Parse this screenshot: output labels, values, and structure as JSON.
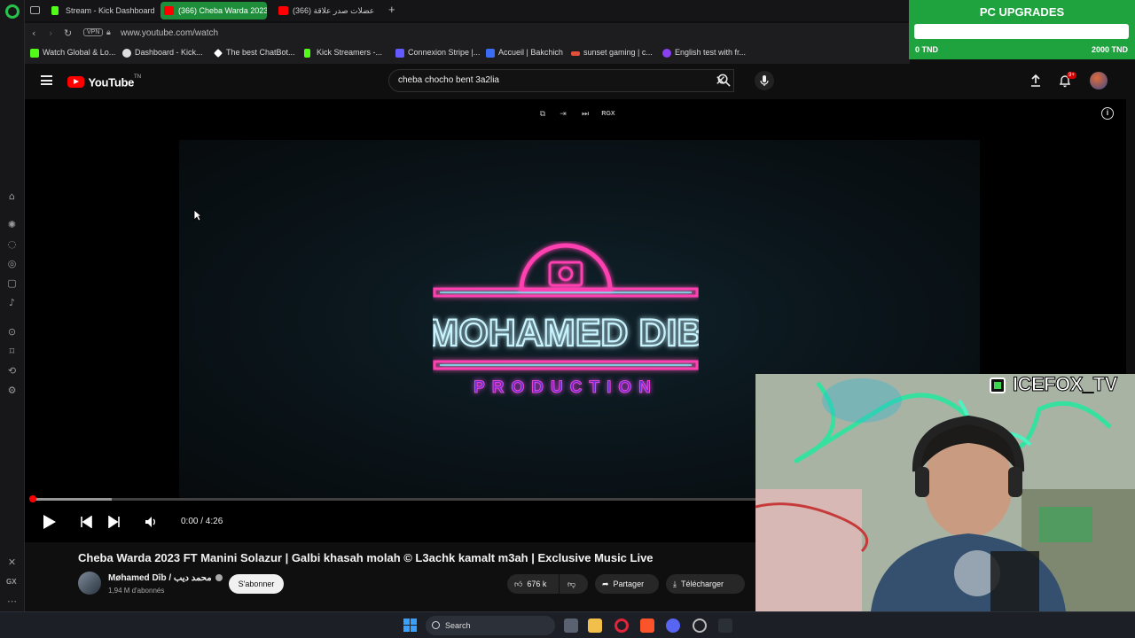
{
  "browser": {
    "tabs": [
      {
        "label": "Stream - Kick Dashboard",
        "icon": "kick-icon",
        "color": "#53fc18",
        "active": false
      },
      {
        "label": "(366) Cheba Warda 2023",
        "icon": "youtube-icon",
        "color": "#ff0000",
        "active": true
      },
      {
        "label": "(366) عضلات صدر علاقة",
        "icon": "youtube-icon",
        "color": "#ff0000",
        "active": false
      }
    ],
    "url": "www.youtube.com/watch",
    "vpn_label": "VPN",
    "bookmarks": [
      {
        "label": "Watch Global & Lo...",
        "icon": "twitch-green-icon",
        "color": "#53fc18"
      },
      {
        "label": "Dashboard - Kick...",
        "icon": "kick-icon",
        "color": "#dddddd"
      },
      {
        "label": "The best ChatBot...",
        "icon": "chatbot-icon",
        "color": "#ffffff"
      },
      {
        "label": "Kick Streamers -...",
        "icon": "kick-icon",
        "color": "#53fc18"
      },
      {
        "label": "Connexion Stripe |...",
        "icon": "stripe-icon",
        "color": "#635bff"
      },
      {
        "label": "Accueil | Bakchich",
        "icon": "bakchich-icon",
        "color": "#3b6cf6"
      },
      {
        "label": "sunset gaming | c...",
        "icon": "sunset-icon",
        "color": "#e2503a"
      },
      {
        "label": "English test with fr...",
        "icon": "english-test-icon",
        "color": "#8a3ff0"
      }
    ]
  },
  "widget": {
    "title": "PC UPGRADES",
    "min_label": "0 TND",
    "max_label": "2000 TND",
    "progress": 0
  },
  "youtube": {
    "logo_text": "YouTube",
    "logo_suffix": "TN",
    "search_query": "cheba chocho bent 3a2lia",
    "notification_badge": "9+",
    "player": {
      "toolbar_label": "RGX",
      "time_display": "0:00 / 4:26",
      "played_fraction": 0,
      "buffered_fraction": 0.11
    },
    "video_logo": {
      "line1": "MOHAMED DIB",
      "line2": "PRODUCTION"
    },
    "video_title": "Cheba Warda 2023 FT Manini Solazur | Galbi khasah molah © L3achk kamalt m3ah | Exclusive Music Live",
    "channel": {
      "name": "Møhamed Dîb / محمد ديب",
      "subscribers": "1,94 M d'abonnés",
      "subscribe_label": "S'abonner"
    },
    "actions": {
      "likes": "676 k",
      "share": "Partager",
      "download": "Télécharger"
    }
  },
  "webcam": {
    "overlay_name": "ICEFOX_TV"
  },
  "taskbar": {
    "search_label": "Search"
  }
}
